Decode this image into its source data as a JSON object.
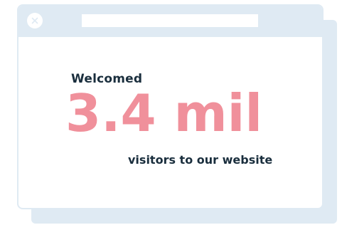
{
  "window": {
    "close_icon": "close-icon",
    "address_bar_value": ""
  },
  "stat": {
    "intro": "Welcomed",
    "value": "3.4 mil",
    "description": "visitors to our website"
  },
  "colors": {
    "frame": "#dfeaf3",
    "accent": "#f0909b",
    "text": "#1a2e3d"
  }
}
